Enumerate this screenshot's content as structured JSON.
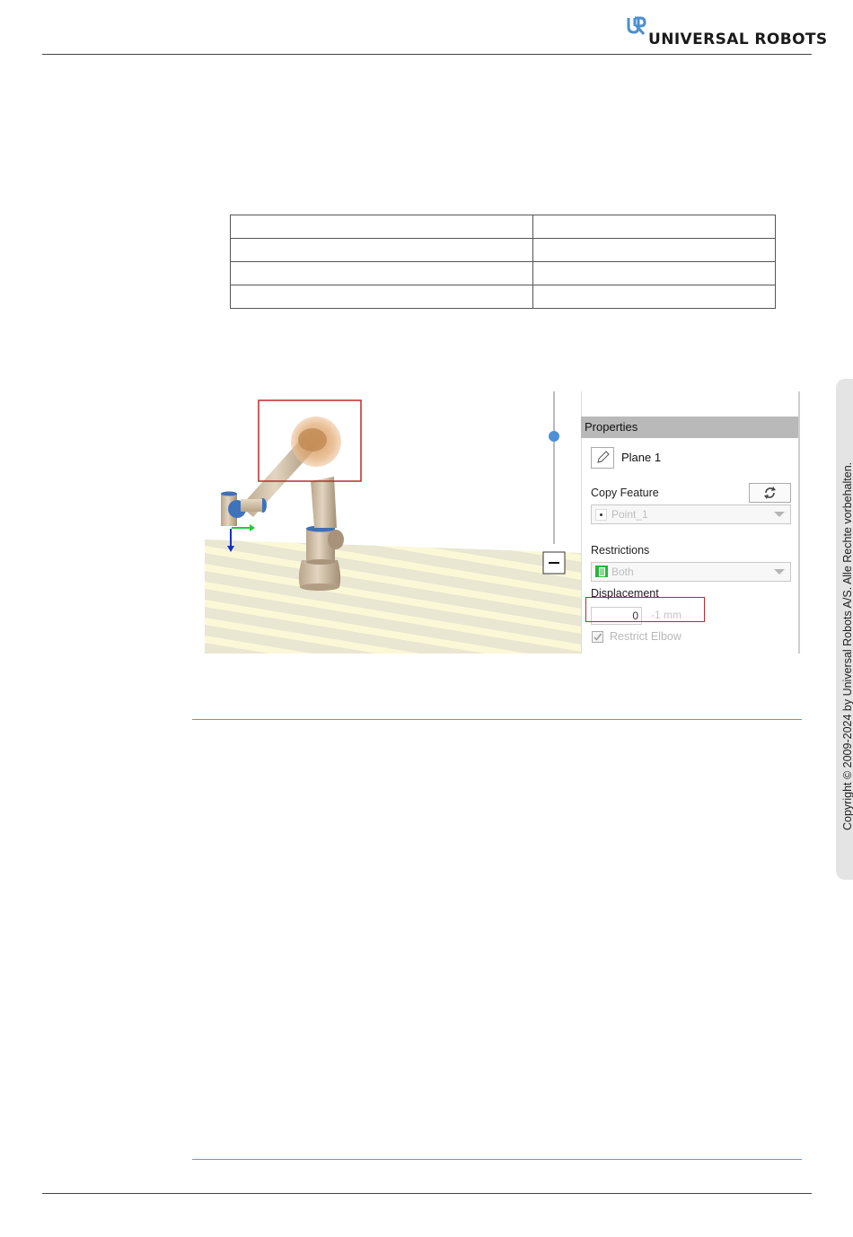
{
  "header": {
    "brand_text": "UNIVERSAL ROBOTS",
    "brand_color": "#4a8fd0"
  },
  "table": {
    "rows": 4,
    "columns": 2,
    "cells": [
      [
        "",
        ""
      ],
      [
        "",
        ""
      ],
      [
        "",
        ""
      ],
      [
        "",
        ""
      ]
    ]
  },
  "figure": {
    "properties_panel": {
      "title": "Properties",
      "name_field_value": "Plane 1",
      "copy_feature_label": "Copy Feature",
      "copy_feature_value": "Point_1",
      "restrictions_label": "Restrictions",
      "restrictions_value": "Both",
      "displacement_label": "Displacement",
      "displacement_value": "0",
      "displacement_unit": "-1 mm",
      "restrict_elbow_label": "Restrict Elbow",
      "restrict_elbow_checked": true,
      "highlight_color": "#c0282a"
    },
    "icons": [
      "pencil-icon",
      "rotate-icon",
      "point-icon",
      "minus-icon",
      "checkbox-icon"
    ]
  },
  "sidebar": {
    "copyright": "Copyright © 2009-2024 by Universal Robots A/S. Alle Rechte vorbehalten."
  }
}
